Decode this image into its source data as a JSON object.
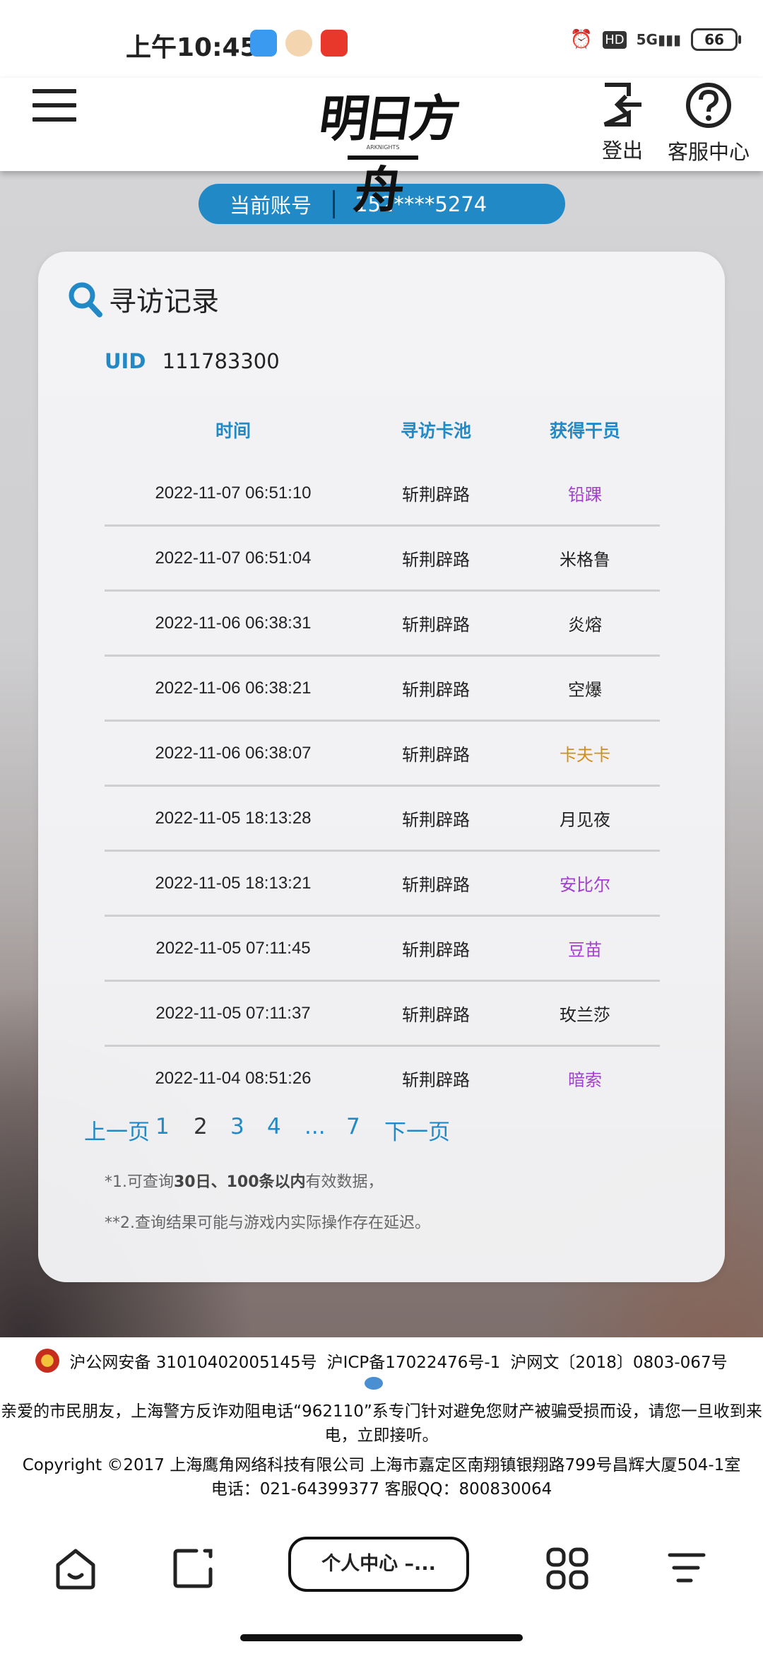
{
  "status_bar": {
    "time": "上午10:45",
    "network": "5G",
    "hd": "HD",
    "battery": "66"
  },
  "header": {
    "logo_text": "明日方舟",
    "logo_sub": "ARKNIGHTS",
    "logout_label": "登出",
    "support_label": "客服中心"
  },
  "account": {
    "label": "当前账号",
    "value": "152****5274"
  },
  "records": {
    "title": "寻访记录",
    "uid_label": "UID",
    "uid_value": "111783300",
    "columns": [
      "时间",
      "寻访卡池",
      "获得干员"
    ],
    "rows": [
      {
        "time": "2022-11-07 06:51:10",
        "pool": "斩荆辟路",
        "operator": "铅踝",
        "color": "#a23fd0"
      },
      {
        "time": "2022-11-07 06:51:04",
        "pool": "斩荆辟路",
        "operator": "米格鲁",
        "color": "#222222"
      },
      {
        "time": "2022-11-06 06:38:31",
        "pool": "斩荆辟路",
        "operator": "炎熔",
        "color": "#222222"
      },
      {
        "time": "2022-11-06 06:38:21",
        "pool": "斩荆辟路",
        "operator": "空爆",
        "color": "#222222"
      },
      {
        "time": "2022-11-06 06:38:07",
        "pool": "斩荆辟路",
        "operator": "卡夫卡",
        "color": "#d08e1b"
      },
      {
        "time": "2022-11-05 18:13:28",
        "pool": "斩荆辟路",
        "operator": "月见夜",
        "color": "#222222"
      },
      {
        "time": "2022-11-05 18:13:21",
        "pool": "斩荆辟路",
        "operator": "安比尔",
        "color": "#a23fd0"
      },
      {
        "time": "2022-11-05 07:11:45",
        "pool": "斩荆辟路",
        "operator": "豆苗",
        "color": "#a23fd0"
      },
      {
        "time": "2022-11-05 07:11:37",
        "pool": "斩荆辟路",
        "operator": "玫兰莎",
        "color": "#222222"
      },
      {
        "time": "2022-11-04 08:51:26",
        "pool": "斩荆辟路",
        "operator": "暗索",
        "color": "#a23fd0"
      }
    ]
  },
  "pagination": {
    "prev": "上一页",
    "p1": "1",
    "p2": "2",
    "p3": "3",
    "p4": "4",
    "ellipsis": "...",
    "p7": "7",
    "next": "下一页",
    "current": "2"
  },
  "notes": {
    "n1_a": "*1.可查询",
    "n1_b": "30日、100条以内",
    "n1_c": "有效数据，",
    "n2": "**2.查询结果可能与游戏内实际操作存在延迟。"
  },
  "footer": {
    "police": "沪公网安备 31010402005145号",
    "icp": "沪ICP备17022476号-1",
    "wenhua": "沪网文〔2018〕0803-067号",
    "warning": "亲爱的市民朋友，上海警方反诈劝阻电话“962110”系专门针对避免您财产被骗受损而设，请您一旦收到来电，立即接听。",
    "copyright": "Copyright ©2017 上海鹰角网络科技有限公司 上海市嘉定区南翔镇银翔路799号昌辉大厦504-1室",
    "contact": "电话：021-64399377 客服QQ：800830064"
  },
  "browser_bar": {
    "tab_label": "个人中心 –..."
  },
  "colors": {
    "accent": "#2289c7",
    "six_star": "#d08e1b",
    "four_star": "#a23fd0"
  }
}
